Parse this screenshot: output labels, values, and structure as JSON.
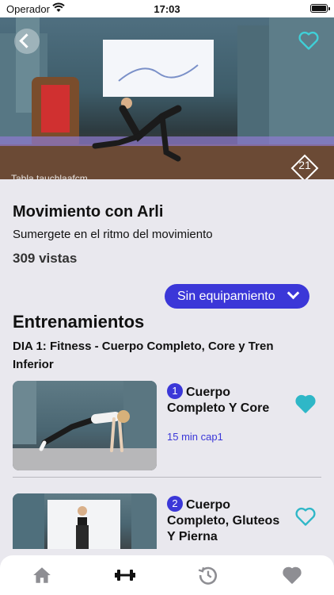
{
  "status_bar": {
    "carrier": "Operador",
    "time": "17:03"
  },
  "hero": {
    "caption": "Tabla tauchlaafcm",
    "badge": "21",
    "back_icon": "chevron-left-icon",
    "favorite_icon": "heart-outline-icon"
  },
  "program": {
    "title": "Movimiento con Arli",
    "subtitle": "Sumergete en el ritmo del movimiento",
    "views": "309 vistas"
  },
  "equipment_filter": {
    "label": "Sin equipamiento"
  },
  "section": {
    "title": "Entrenamientos",
    "day": "DIA 1: Fitness - Cuerpo Completo, Core y Tren Inferior"
  },
  "workouts": [
    {
      "number": "1",
      "title": "Cuerpo Completo Y Core",
      "duration": "15 min cap1",
      "favorited": true
    },
    {
      "number": "2",
      "title": "Cuerpo Completo, Gluteos Y Pierna",
      "duration": "",
      "favorited": false
    }
  ],
  "tab_bar": {
    "items": [
      {
        "icon": "home-icon"
      },
      {
        "icon": "dumbbell-icon",
        "active": true
      },
      {
        "icon": "history-icon"
      },
      {
        "icon": "heart-icon"
      }
    ]
  },
  "colors": {
    "accent": "#3b37d8",
    "teal": "#2fb7c7",
    "inactive": "#8e8e93",
    "background": "#e9e8ee"
  }
}
